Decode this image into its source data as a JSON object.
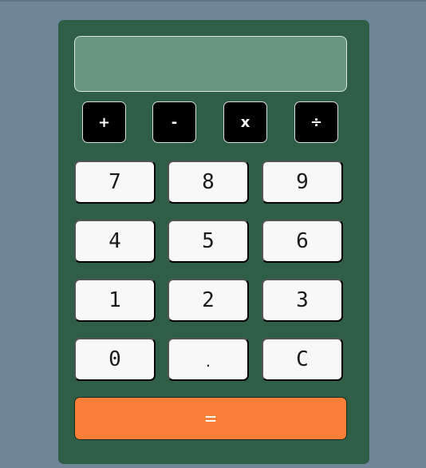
{
  "display": {
    "value": ""
  },
  "operators": {
    "add": "+",
    "subtract": "-",
    "multiply": "x",
    "divide": "÷"
  },
  "keys": {
    "seven": "7",
    "eight": "8",
    "nine": "9",
    "four": "4",
    "five": "5",
    "six": "6",
    "one": "1",
    "two": "2",
    "three": "3",
    "zero": "0",
    "decimal": ".",
    "clear": "C"
  },
  "equals": {
    "label": "="
  },
  "colors": {
    "page_background": "#6f8598",
    "calculator_body": "#2e5e46",
    "display_background": "#68957e",
    "operator_background": "#000000",
    "key_background": "#f8f8f8",
    "equals_background": "#f87f38"
  }
}
